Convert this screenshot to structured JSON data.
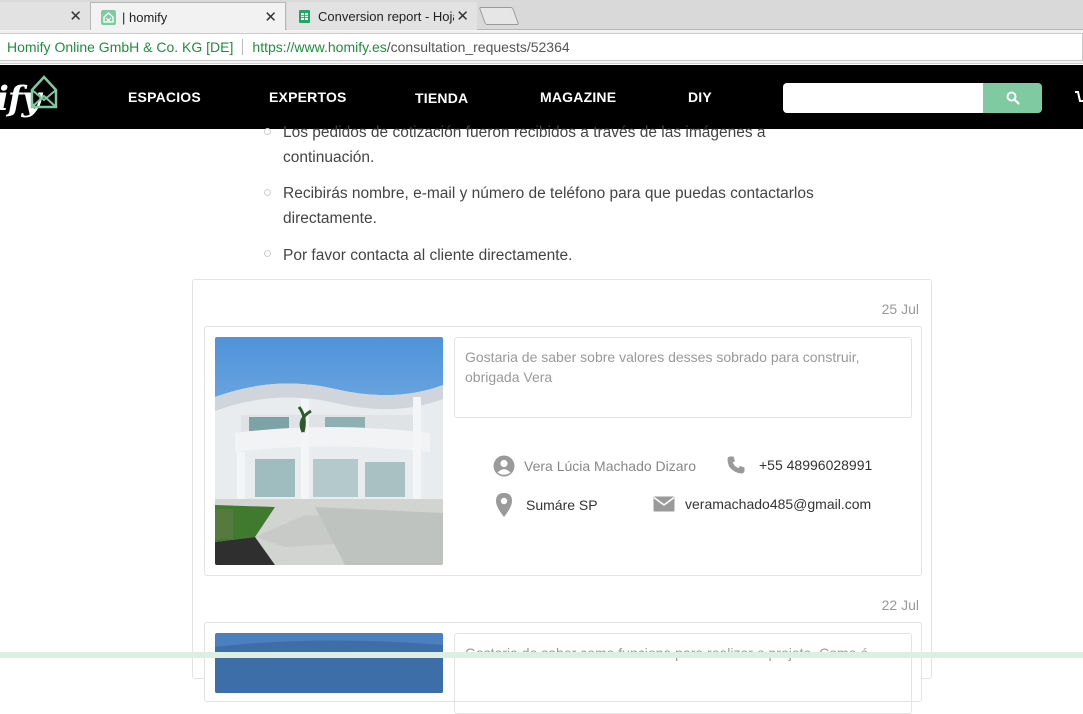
{
  "browser": {
    "tabs": [
      {
        "title": "",
        "close": "✕",
        "active": false
      },
      {
        "title": "| homify",
        "close": "✕",
        "active": true
      },
      {
        "title": "Conversion report - Hoja",
        "close": "✕",
        "active": false
      }
    ],
    "address": {
      "security_label": "Homify Online GmbH & Co. KG [DE]",
      "url_host": "https://www.homify.es",
      "url_path": "/consultation_requests/52364"
    }
  },
  "nav": {
    "logo_text": "ify",
    "items": [
      "ESPACIOS",
      "EXPERTOS",
      "TIENDA",
      "MAGAZINE",
      "DIY"
    ],
    "search_placeholder": ""
  },
  "instructions": [
    {
      "line1": "Los pedidos de cotización fueron recibidos a través de las imágenes a",
      "line2": "continuación."
    },
    {
      "line1": "Recibirás nombre, e-mail y número de teléfono para que puedas contactarlos",
      "line2": "directamente."
    },
    {
      "line1": "Por favor contacta al cliente directamente.",
      "line2": ""
    }
  ],
  "requests": [
    {
      "date": "25 Jul",
      "message": "Gostaria de saber sobre valores desses sobrado para construir, obrigada Vera",
      "name": "Vera Lúcia Machado Dizaro",
      "phone": "+55 48996028991",
      "location": "Sumáre SP",
      "email": "veramachado485@gmail.com"
    },
    {
      "date": "22 Jul",
      "message": "Gostaria de saber como funciona para realizar o projeto. Como é"
    }
  ],
  "colors": {
    "accent": "#7fcaa0",
    "nav_bg": "#000000",
    "icon_gray": "#9a9a9a"
  }
}
